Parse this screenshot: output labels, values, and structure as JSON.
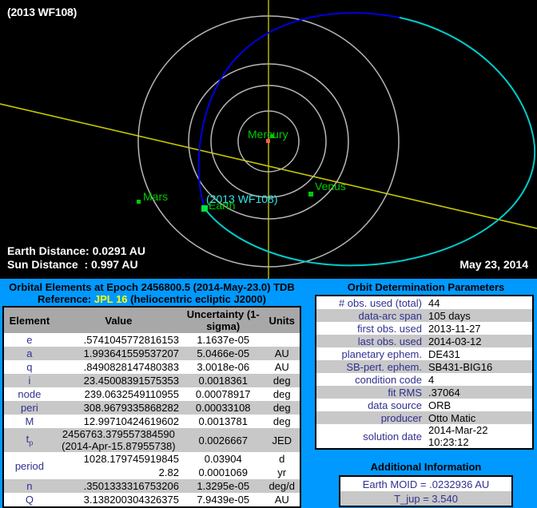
{
  "viewer": {
    "object_title": "(2013 WF108)",
    "earth_distance_line": "Earth Distance: 0.0291 AU",
    "sun_distance_line": "Sun Distance  : 0.997 AU",
    "date": "May 23, 2014",
    "labels": {
      "mercury": "Mercury",
      "venus": "Venus",
      "earth": "Earth",
      "mars": "Mars",
      "object": "(2013 WF108)"
    },
    "colors": {
      "background": "#000000",
      "planet_orbit": "#b4b4b4",
      "object_orbit_above": "#0000dd",
      "object_orbit_below": "#00cccc",
      "axis": "#b0b000",
      "sun": "#ff5544",
      "planet_marker": "#00cc00",
      "earth_marker": "#00ee44",
      "planet_label": "#00cc00",
      "object_label": "#2ee6e6"
    }
  },
  "elements_panel": {
    "title": "Orbital Elements at Epoch 2456800.5 (2014-May-23.0) TDB",
    "reference_prefix": "Reference:",
    "reference_link": "JPL 16",
    "reference_suffix": "(heliocentric ecliptic J2000)",
    "headers": [
      "Element",
      "Value",
      "Uncertainty (1-sigma)",
      "Units"
    ],
    "rows": [
      {
        "element": "e",
        "value": ".5741045772816153",
        "uncertainty": "1.1637e-05",
        "units": ""
      },
      {
        "element": "a",
        "value": "1.993641559537207",
        "uncertainty": "5.0466e-05",
        "units": "AU"
      },
      {
        "element": "q",
        "value": ".8490828147480383",
        "uncertainty": "3.0018e-06",
        "units": "AU"
      },
      {
        "element": "i",
        "value": "23.45008391575353",
        "uncertainty": "0.0018361",
        "units": "deg"
      },
      {
        "element": "node",
        "value": "239.0632549110955",
        "uncertainty": "0.00078917",
        "units": "deg"
      },
      {
        "element": "peri",
        "value": "308.9679335868282",
        "uncertainty": "0.00033108",
        "units": "deg"
      },
      {
        "element": "M",
        "value": "12.99710424619602",
        "uncertainty": "0.0013781",
        "units": "deg"
      },
      {
        "element": "tp",
        "value": "2456763.379557384590",
        "value2": "(2014-Apr-15.87955738)",
        "uncertainty": "0.0026667",
        "units": "JED"
      },
      {
        "element": "period",
        "value": "1028.179745919845",
        "uncertainty": "0.03904",
        "units": "d"
      },
      {
        "element": "",
        "value": "2.82",
        "uncertainty": "0.0001069",
        "units": "yr"
      },
      {
        "element": "n",
        "value": ".3501333316753206",
        "uncertainty": "1.3295e-05",
        "units": "deg/d"
      },
      {
        "element": "Q",
        "value": "3.138200304326375",
        "uncertainty": "7.9439e-05",
        "units": "AU"
      }
    ]
  },
  "determination_panel": {
    "title": "Orbit Determination Parameters",
    "rows": [
      {
        "key": "# obs. used (total)",
        "value": "44"
      },
      {
        "key": "data-arc span",
        "value": "105 days"
      },
      {
        "key": "first obs. used",
        "value": "2013-11-27"
      },
      {
        "key": "last obs. used",
        "value": "2014-03-12"
      },
      {
        "key": "planetary ephem.",
        "value": "DE431"
      },
      {
        "key": "SB-pert. ephem.",
        "value": "SB431-BIG16"
      },
      {
        "key": "condition code",
        "value": "4"
      },
      {
        "key": "fit RMS",
        "value": ".37064"
      },
      {
        "key": "data source",
        "value": "ORB"
      },
      {
        "key": "producer",
        "value": "Otto Matic"
      },
      {
        "key": "solution date",
        "value": "2014-Mar-22 10:23:12"
      }
    ]
  },
  "additional_panel": {
    "title": "Additional Information",
    "rows": [
      {
        "text": "Earth MOID = .0232936 AU"
      },
      {
        "text": "T_jup = 3.540"
      }
    ]
  }
}
